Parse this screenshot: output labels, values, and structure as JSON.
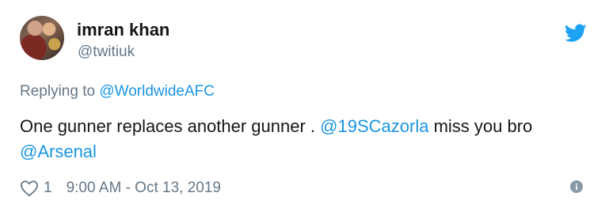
{
  "author": {
    "name": "imran khan",
    "handle": "@twitiuk",
    "avatar_icon": "avatar-photo"
  },
  "brand": {
    "icon": "twitter-bird-icon",
    "color": "#1da1f2"
  },
  "reply": {
    "prefix": "Replying to",
    "target": "@WorldwideAFC"
  },
  "tweet": {
    "text_part1": "One gunner replaces another gunner . ",
    "mention1": "@19SCazorla",
    "text_part2": " miss you bro ",
    "mention2": "@Arsenal"
  },
  "footer": {
    "likes_count": "1",
    "timestamp": "9:00 AM - Oct 13, 2019",
    "like_icon": "heart-icon",
    "info_icon": "info-icon",
    "info_glyph": "i"
  },
  "colors": {
    "link": "#1b95e0",
    "secondary_text": "#657786",
    "primary_text": "#14171a"
  }
}
